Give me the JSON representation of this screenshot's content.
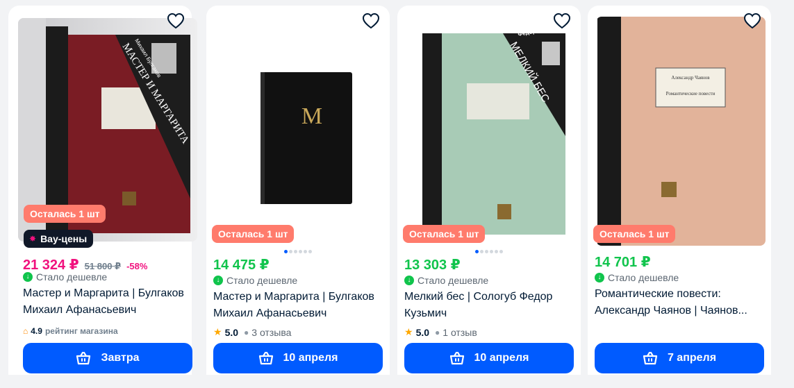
{
  "colors": {
    "accent": "#005bff",
    "price_green": "#10c44c",
    "price_discount": "#f1117e",
    "badge_stock": "#ff7b6c",
    "badge_wow": "#101828"
  },
  "products": [
    {
      "stock_badge": "Осталась 1 шт",
      "wow_badge": "Вау-цены",
      "price": "21 324 ₽",
      "old_price": "51 800 ₽",
      "discount": "-58%",
      "cheaper": "Стало дешевле",
      "title": "Мастер и Маргарита | Булгаков Михаил Афанасьевич",
      "rating": "4.9",
      "rating_label": "рейтинг магазина",
      "button": "Завтра",
      "cover_author": "Михаил Булгаков",
      "cover_title": "МАСТЕР И МАРГАРИТА"
    },
    {
      "stock_badge": "Осталась 1 шт",
      "price": "14 475 ₽",
      "cheaper": "Стало дешевле",
      "title": "Мастер и Маргарита | Булгаков Михаил Афанасьевич",
      "rating": "5.0",
      "reviews": "3 отзыва",
      "button": "10 апреля",
      "cover_letter": "М"
    },
    {
      "stock_badge": "Осталась 1 шт",
      "price": "13 303 ₽",
      "cheaper": "Стало дешевле",
      "title": "Мелкий бес | Сологуб Федор Кузьмич",
      "rating": "5.0",
      "reviews": "1 отзыв",
      "button": "10 апреля",
      "cover_author": "Фёдор СОЛОГУБ",
      "cover_title": "МЕЛКИЙ БЕС"
    },
    {
      "stock_badge": "Осталась 1 шт",
      "price": "14 701 ₽",
      "cheaper": "Стало дешевле",
      "title": "Романтические повести: Александр Чаянов | Чаянов...",
      "button": "7 апреля",
      "cover_author": "Александр Чаянов",
      "cover_title": "Романтические повести"
    }
  ]
}
